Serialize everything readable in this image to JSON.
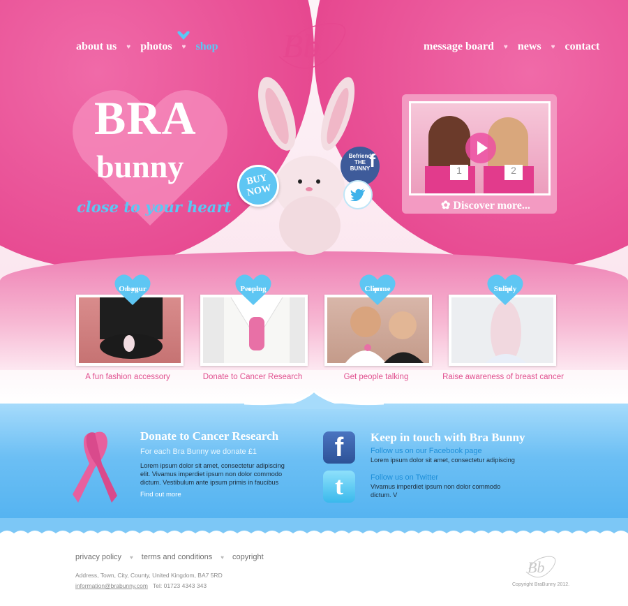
{
  "nav_left": [
    {
      "label": "about us"
    },
    {
      "label": "photos"
    },
    {
      "label": "shop"
    }
  ],
  "nav_right": [
    {
      "label": "message board"
    },
    {
      "label": "news"
    },
    {
      "label": "contact"
    }
  ],
  "logo_text": "Bb",
  "hero": {
    "title_line1": "BRA",
    "title_line2": "bunny",
    "tagline": "close to your heart"
  },
  "badges": {
    "buy_now_line1": "BUY",
    "buy_now_line2": "NOW",
    "facebook_line1": "Befriend",
    "facebook_line2": "THE",
    "facebook_line3": "BUNNY",
    "facebook_glyph": "f"
  },
  "video": {
    "discover_label": "Discover more...",
    "card_1": "1",
    "card_2": "2"
  },
  "features": [
    {
      "heart_line1": "On your",
      "heart_line2": "bag",
      "caption": "A fun fashion accessory"
    },
    {
      "heart_line1": "Peeping",
      "heart_line2": "out",
      "caption": "Donate to Cancer Research"
    },
    {
      "heart_line1": "Clip me",
      "heart_line2": "on",
      "caption": "Get people talking"
    },
    {
      "heart_line1": "Sturdy",
      "heart_line2": "clip",
      "caption": "Raise awareness of breast cancer"
    }
  ],
  "donate": {
    "heading": "Donate to Cancer Research",
    "subheading": "For each Bra Bunny we donate £1",
    "body_1": "Lorem ipsum dolor sit amet, consectetur adipiscing",
    "body_2": "elit. Vivamus imperdiet ipsum non dolor commodo",
    "body_3": "dictum. Vestibulum ante ipsum primis in faucibus",
    "link": "Find out more"
  },
  "social": {
    "heading": "Keep in touch with Bra Bunny",
    "facebook_link": "Follow us on our Facebook page",
    "facebook_text": "Lorem ipsum dolor sit amet, consectetur adipiscing",
    "twitter_link": "Follow us on Twitter",
    "twitter_text_1": "Vivamus imperdiet ipsum non dolor commodo",
    "twitter_text_2": "dictum. V",
    "facebook_glyph": "f",
    "twitter_glyph": "t"
  },
  "footer": {
    "links": [
      {
        "label": "privacy policy"
      },
      {
        "label": "terms and conditions"
      },
      {
        "label": "copyright"
      }
    ],
    "address": "Address, Town, City, County, United Kingdom, BA7 5RD",
    "email": "information@brabunny.com",
    "tel": "Tel:  01723 4343 343",
    "copyright": "Copyright BraBunny 2012.",
    "logo_text": "Bb"
  },
  "colors": {
    "pink": "#e6478f",
    "blue": "#5ac8f5",
    "deep_blue": "#1d8ed8"
  }
}
